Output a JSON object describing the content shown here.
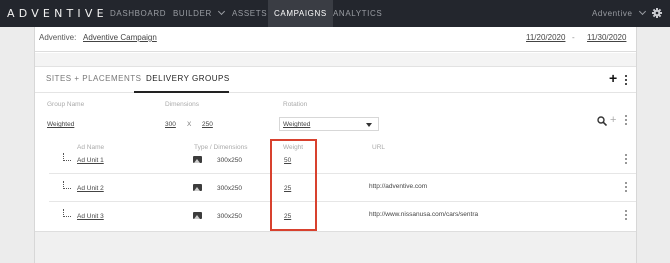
{
  "nav": {
    "brand": "ADVENTIVE",
    "items": [
      "DASHBOARD",
      "BUILDER",
      "ASSETS",
      "CAMPAIGNS",
      "ANALYTICS"
    ],
    "user": "Adventive"
  },
  "advertiser": {
    "label": "Adventive:",
    "campaign": "Adventive Campaign",
    "start_date": "11/20/2020",
    "separator": "-",
    "end_date": "11/30/2020"
  },
  "tabs": [
    "SITES + PLACEMENTS",
    "DELIVERY GROUPS"
  ],
  "group": {
    "headers": {
      "name": "Group Name",
      "dimensions": "Dimensions",
      "rotation": "Rotation"
    },
    "name": "Weighted",
    "width": "300",
    "x": "X",
    "height": "250",
    "rotation": "Weighted"
  },
  "units": {
    "headers": {
      "name": "Ad Name",
      "type": "Type / Dimensions",
      "weight": "Weight",
      "url": "URL"
    },
    "rows": [
      {
        "name": "Ad Unit 1",
        "dims": "300x250",
        "weight": "50",
        "url": ""
      },
      {
        "name": "Ad Unit 2",
        "dims": "300x250",
        "weight": "25",
        "url": "http://adventive.com"
      },
      {
        "name": "Ad Unit 3",
        "dims": "300x250",
        "weight": "25",
        "url": "http://www.nissanusa.com/cars/sentra"
      }
    ]
  },
  "colors": {
    "nav_bg": "#23262d",
    "highlight": "#d8412e"
  }
}
